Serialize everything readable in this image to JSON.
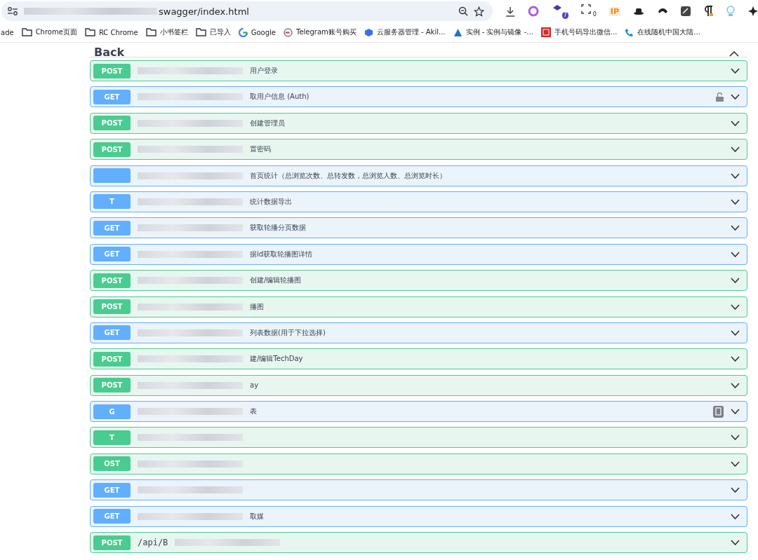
{
  "browser": {
    "url": "swagger/index.html",
    "extension_badges": [
      "7",
      "0"
    ],
    "ip_label": "IP",
    "bookmarks": [
      {
        "label": "ade",
        "kind": "text"
      },
      {
        "label": "Chrome页面",
        "kind": "folder"
      },
      {
        "label": "RC Chrome",
        "kind": "folder"
      },
      {
        "label": "小书签栏",
        "kind": "folder"
      },
      {
        "label": "已导入",
        "kind": "folder"
      },
      {
        "label": "Google",
        "kind": "google"
      },
      {
        "label": "Telegram账号购买",
        "kind": "site"
      },
      {
        "label": "云服务器管理 - Akil...",
        "kind": "cube"
      },
      {
        "label": "实例 - 实例与镜像 -...",
        "kind": "peak"
      },
      {
        "label": "手机号码导出微信...",
        "kind": "red"
      },
      {
        "label": "在线随机中国大陆...",
        "kind": "phone"
      }
    ]
  },
  "section": {
    "title": "Back",
    "expanded": true
  },
  "operations": [
    {
      "kind": "post",
      "badge": "POST",
      "summary": "用户登录",
      "redacted": true,
      "locked": false,
      "copy_button": false
    },
    {
      "kind": "get",
      "badge": "GET",
      "summary": "取用户信息 (Auth)",
      "redacted": true,
      "locked": true,
      "copy_button": false
    },
    {
      "kind": "post",
      "badge": "POST",
      "summary": "创建管理员",
      "redacted": true,
      "locked": false,
      "copy_button": false
    },
    {
      "kind": "post",
      "badge": "POST",
      "summary": "置密码",
      "redacted": true,
      "locked": false,
      "copy_button": false
    },
    {
      "kind": "get",
      "summary": "首页统计（总浏览次数、总转发数，总浏览人数、总浏览时长）",
      "redacted": true,
      "locked": false,
      "copy_button": false
    },
    {
      "kind": "get",
      "badge": "T",
      "summary": "统计数据导出",
      "redacted": true,
      "locked": false,
      "copy_button": false
    },
    {
      "kind": "get",
      "badge": "GET",
      "summary": "获取轮播分页数据",
      "redacted": true,
      "locked": false,
      "copy_button": false
    },
    {
      "kind": "get",
      "badge": "GET",
      "summary": "据id获取轮播图详情",
      "redacted": true,
      "locked": false,
      "copy_button": false
    },
    {
      "kind": "post",
      "badge": "POST",
      "summary": "创建/编辑轮播图",
      "redacted": true,
      "locked": false,
      "copy_button": false
    },
    {
      "kind": "post",
      "badge": "POST",
      "summary": "播图",
      "redacted": true,
      "locked": false,
      "copy_button": false
    },
    {
      "kind": "get",
      "badge": "GET",
      "summary": "列表数据(用于下拉选择)",
      "redacted": true,
      "locked": false,
      "copy_button": false
    },
    {
      "kind": "post",
      "badge": "POST",
      "summary": "建/编辑TechDay",
      "redacted": true,
      "locked": false,
      "copy_button": false
    },
    {
      "kind": "post",
      "badge": "POST",
      "summary": "ay",
      "redacted": true,
      "locked": false,
      "copy_button": false
    },
    {
      "kind": "get",
      "badge": "G",
      "summary": "表",
      "redacted": true,
      "locked": false,
      "copy_button": true
    },
    {
      "kind": "post",
      "badge": "T",
      "redacted": true,
      "locked": false,
      "copy_button": false
    },
    {
      "kind": "post",
      "badge": "OST",
      "redacted": true,
      "locked": false,
      "copy_button": false
    },
    {
      "kind": "get",
      "badge": "GET",
      "redacted": true,
      "locked": false,
      "copy_button": false
    },
    {
      "kind": "get",
      "badge": "GET",
      "summary": "取媒",
      "redacted": true,
      "locked": false,
      "copy_button": false
    },
    {
      "kind": "post",
      "badge": "POST",
      "path": "/api/B",
      "redacted": true,
      "locked": false,
      "copy_button": false
    }
  ]
}
